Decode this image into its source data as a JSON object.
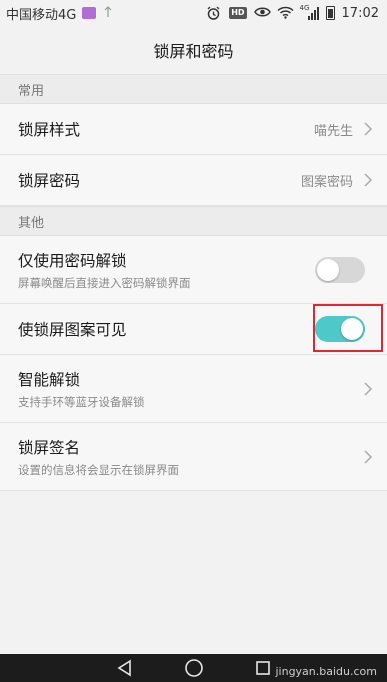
{
  "status_bar": {
    "carrier": "中国移动4G",
    "hd_badge": "HD",
    "signal_label": "4G",
    "time": "17:02"
  },
  "title": "锁屏和密码",
  "sections": [
    {
      "header": "常用",
      "rows": [
        {
          "title": "锁屏样式",
          "value": "喵先生",
          "type": "chevron"
        },
        {
          "title": "锁屏密码",
          "value": "图案密码",
          "type": "chevron"
        }
      ]
    },
    {
      "header": "其他",
      "rows": [
        {
          "title": "仅使用密码解锁",
          "subtitle": "屏幕唤醒后直接进入密码解锁界面",
          "type": "toggle",
          "enabled": false
        },
        {
          "title": "使锁屏图案可见",
          "type": "toggle",
          "enabled": true,
          "highlighted": true
        },
        {
          "title": "智能解锁",
          "subtitle": "支持手环等蓝牙设备解锁",
          "type": "chevron"
        },
        {
          "title": "锁屏签名",
          "subtitle": "设置的信息将会显示在锁屏界面",
          "type": "chevron"
        }
      ]
    }
  ],
  "colors": {
    "toggle_on": "#4ec8c8",
    "toggle_off": "#d7d7d7",
    "highlight_box": "#e0262e"
  },
  "nav_icons": [
    "back-icon",
    "home-icon",
    "recents-icon"
  ],
  "watermark": "jingyan.baidu.com"
}
